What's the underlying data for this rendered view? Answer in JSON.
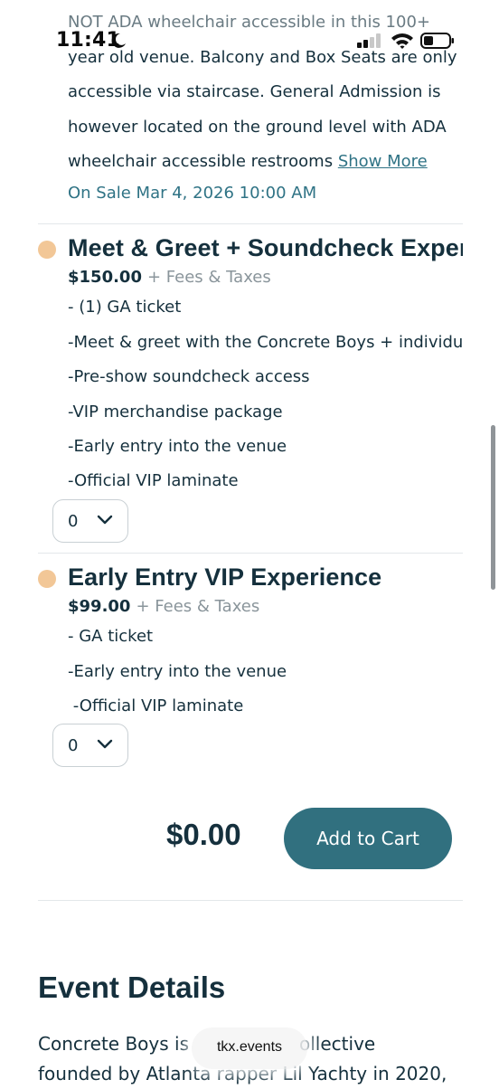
{
  "status_bar": {
    "time": "11:41"
  },
  "event_info": {
    "accessibility_lines": [
      "NOT ADA wheelchair accessible in this 100+",
      "year old venue. Balcony and Box Seats are only",
      "accessible via staircase. General Admission is",
      "however located on the ground level with ADA",
      "wheelchair accessible restrooms"
    ],
    "show_more_label": "Show More",
    "on_sale": "On Sale Mar 4, 2026 10:00 AM"
  },
  "tiers": [
    {
      "title": "Meet & Greet + Soundcheck Experience",
      "price": "$150.00",
      "fees": "+ Fees & Taxes",
      "perks": [
        "- (1) GA ticket",
        "-Meet & greet with the Concrete Boys + individual",
        "-Pre-show soundcheck access",
        "-VIP merchandise package",
        "-Early entry into the venue",
        "-Official VIP laminate"
      ],
      "quantity": "0"
    },
    {
      "title": "Early Entry VIP Experience",
      "price": "$99.00",
      "fees": "+ Fees & Taxes",
      "perks": [
        "- GA ticket",
        "-Early entry into the venue",
        " -Official VIP laminate"
      ],
      "quantity": "0"
    }
  ],
  "cart": {
    "total": "$0.00",
    "add_label": "Add to Cart"
  },
  "event_details": {
    "title": "Event Details",
    "body_line1_start": "Concrete Boys is",
    "body_line1_end": "ollective",
    "body_line2": "founded by Atlanta rapper Lil Yachty in 2020,"
  },
  "browser": {
    "url": "tkx.events"
  },
  "colors": {
    "accent": "#31707f",
    "link": "#2f7385",
    "text": "#15303d",
    "dot": "#f2c797"
  }
}
